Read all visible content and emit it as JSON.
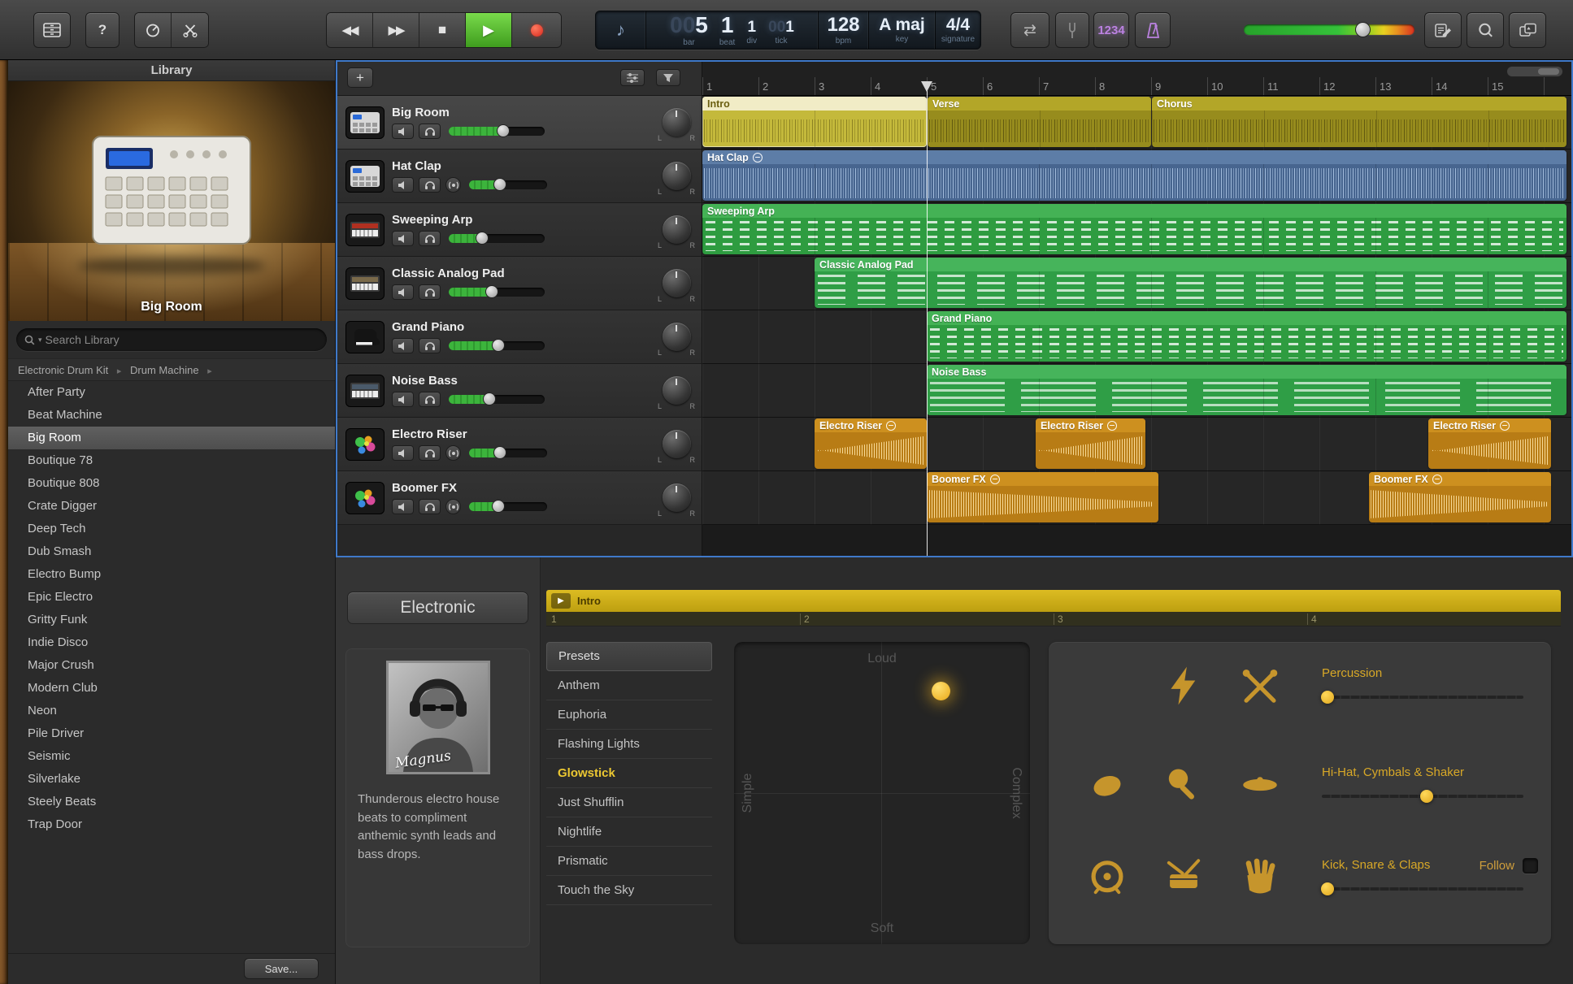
{
  "icons": {
    "rewind": "◀◀",
    "forward": "▶▶",
    "stop": "■",
    "play": "▶",
    "cycle": "⇄",
    "add_track": "+",
    "breadcrumb_separator": "▸",
    "search_scope_arrow": "▾",
    "mini_play": "▶",
    "lcd_note": "♪"
  },
  "toolbar": {
    "help_label": "?",
    "count_in_label": "1234",
    "lcd": {
      "bar_zeros": "00",
      "bar_value": "5",
      "bar_label": "bar",
      "beat_value": "1",
      "beat_label": "beat",
      "div_value": "1",
      "div_label": "div",
      "tick_zeros": "00",
      "tick_value": "1",
      "tick_label": "tick",
      "bpm_value": "128",
      "bpm_label": "bpm",
      "key_value": "A maj",
      "key_label": "key",
      "signature_value": "4/4",
      "signature_label": "signature"
    }
  },
  "library": {
    "title": "Library",
    "patch_name": "Big Room",
    "search_placeholder": "Search Library",
    "breadcrumb": [
      "Electronic Drum Kit",
      "Drum Machine"
    ],
    "items": [
      "After Party",
      "Beat Machine",
      "Big Room",
      "Boutique 78",
      "Boutique 808",
      "Crate Digger",
      "Deep Tech",
      "Dub Smash",
      "Electro Bump",
      "Epic Electro",
      "Gritty Funk",
      "Indie Disco",
      "Major Crush",
      "Modern Club",
      "Neon",
      "Pile Driver",
      "Seismic",
      "Silverlake",
      "Steely Beats",
      "Trap Door"
    ],
    "selected_item": "Big Room",
    "save_label": "Save..."
  },
  "labels": {
    "pan_left": "L",
    "pan_right": "R"
  },
  "tracks": [
    {
      "name": "Big Room"
    },
    {
      "name": "Hat Clap"
    },
    {
      "name": "Sweeping Arp"
    },
    {
      "name": "Classic Analog Pad"
    },
    {
      "name": "Grand Piano"
    },
    {
      "name": "Noise Bass"
    },
    {
      "name": "Electro Riser"
    },
    {
      "name": "Boomer FX"
    }
  ],
  "timeline": {
    "ruler": [
      "1",
      "2",
      "3",
      "4",
      "5",
      "6",
      "7",
      "8",
      "9",
      "10",
      "11",
      "12",
      "13",
      "14",
      "15"
    ],
    "regions": {
      "intro": "Intro",
      "verse": "Verse",
      "chorus": "Chorus",
      "hat_clap": "Hat Clap",
      "sweeping_arp": "Sweeping Arp",
      "classic_analog_pad": "Classic Analog Pad",
      "grand_piano": "Grand Piano",
      "noise_bass": "Noise Bass",
      "electro_riser": "Electro Riser",
      "boomer_fx": "Boomer FX"
    }
  },
  "editor": {
    "style_label": "Electronic",
    "artist_signature": "Magnus",
    "description": "Thunderous electro house beats to compliment anthemic synth leads and bass drops.",
    "region_label": "Intro",
    "mini_ruler": [
      "1",
      "2",
      "3",
      "4"
    ],
    "presets_header": "Presets",
    "presets": [
      "Anthem",
      "Euphoria",
      "Flashing Lights",
      "Glowstick",
      "Just Shufflin",
      "Nightlife",
      "Prismatic",
      "Touch the Sky"
    ],
    "selected_preset": "Glowstick",
    "xy_pad": {
      "top": "Loud",
      "bottom": "Soft",
      "left": "Simple",
      "right": "Complex"
    },
    "groups": [
      {
        "label": "Percussion",
        "value_pct": 3
      },
      {
        "label": "Hi-Hat, Cymbals & Shaker",
        "value_pct": 52
      },
      {
        "label": "Kick, Snare & Claps",
        "value_pct": 3,
        "follow_label": "Follow"
      }
    ]
  },
  "colors": {
    "accent_yellow": "#e8c332",
    "play_green": "#4fc32e",
    "record_red": "#e0392b",
    "count_in_purple": "#bb82e0",
    "region_yellow": "#978c1d",
    "region_blue": "#47658f",
    "region_green": "#2e9c40",
    "region_orange": "#b87c15"
  }
}
